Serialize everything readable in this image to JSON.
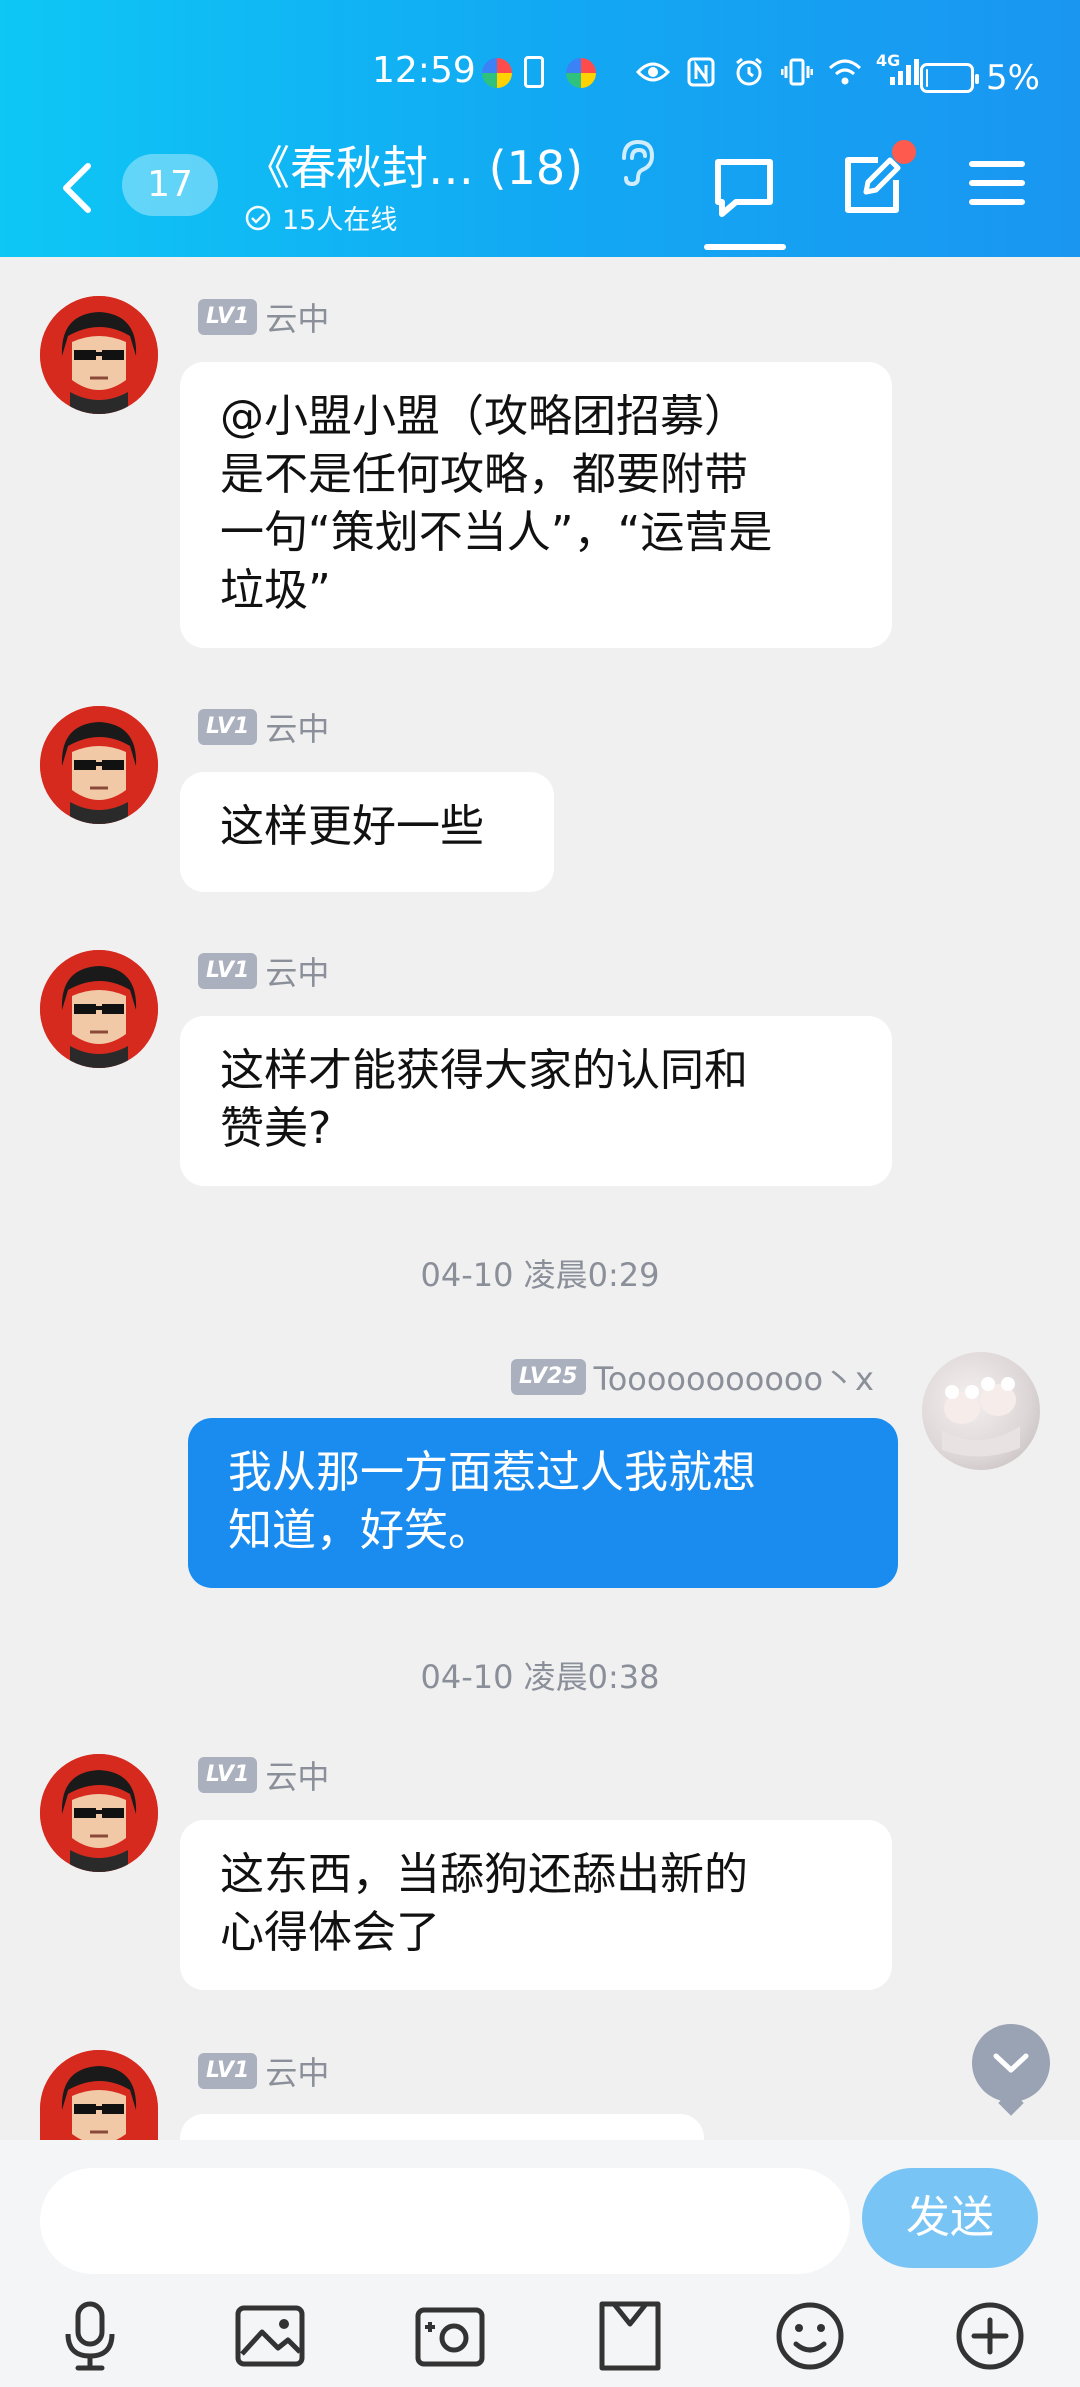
{
  "status_bar": {
    "time": "12:59",
    "network": "4G",
    "battery_percent_text": "5%",
    "battery_level": 0.05
  },
  "header": {
    "unread_count": "17",
    "group_title": "《春秋封…  (18)",
    "online_text": "15人在线",
    "icons": [
      "back-arrow-icon",
      "ear-icon",
      "chat-bubble-icon",
      "compose-icon",
      "menu-icon"
    ]
  },
  "messages": [
    {
      "sender": "云中",
      "level": "LV1",
      "text": "@小盟小盟（攻略团招募）\n是不是任何攻略，都要附带\n一句“策划不当人”，“运营是\n垃圾”"
    },
    {
      "sender": "云中",
      "level": "LV1",
      "text": "这样更好一些"
    },
    {
      "sender": "云中",
      "level": "LV1",
      "text": "这样才能获得大家的认同和\n赞美?"
    },
    {
      "timestamp": "04-10 凌晨0:29"
    },
    {
      "sender": "Tooooooooooo丶x",
      "level": "LV25",
      "self": true,
      "text": "我从那一方面惹过人我就想\n知道，好笑。"
    },
    {
      "timestamp": "04-10 凌晨0:38"
    },
    {
      "sender": "云中",
      "level": "LV1",
      "text": "这东西，当舔狗还舔出新的\n心得体会了"
    },
    {
      "sender": "云中",
      "level": "LV1",
      "text": ""
    }
  ],
  "input": {
    "placeholder": "",
    "send_label": "发送"
  },
  "toolbar": [
    "microphone-icon",
    "image-icon",
    "camera-icon",
    "folder-icon",
    "emoji-icon",
    "plus-icon"
  ],
  "colors": {
    "header_start": "#0ec7f5",
    "header_end": "#1a96f1",
    "self_bubble": "#1a8cf0",
    "send_button": "#78c4f5"
  }
}
